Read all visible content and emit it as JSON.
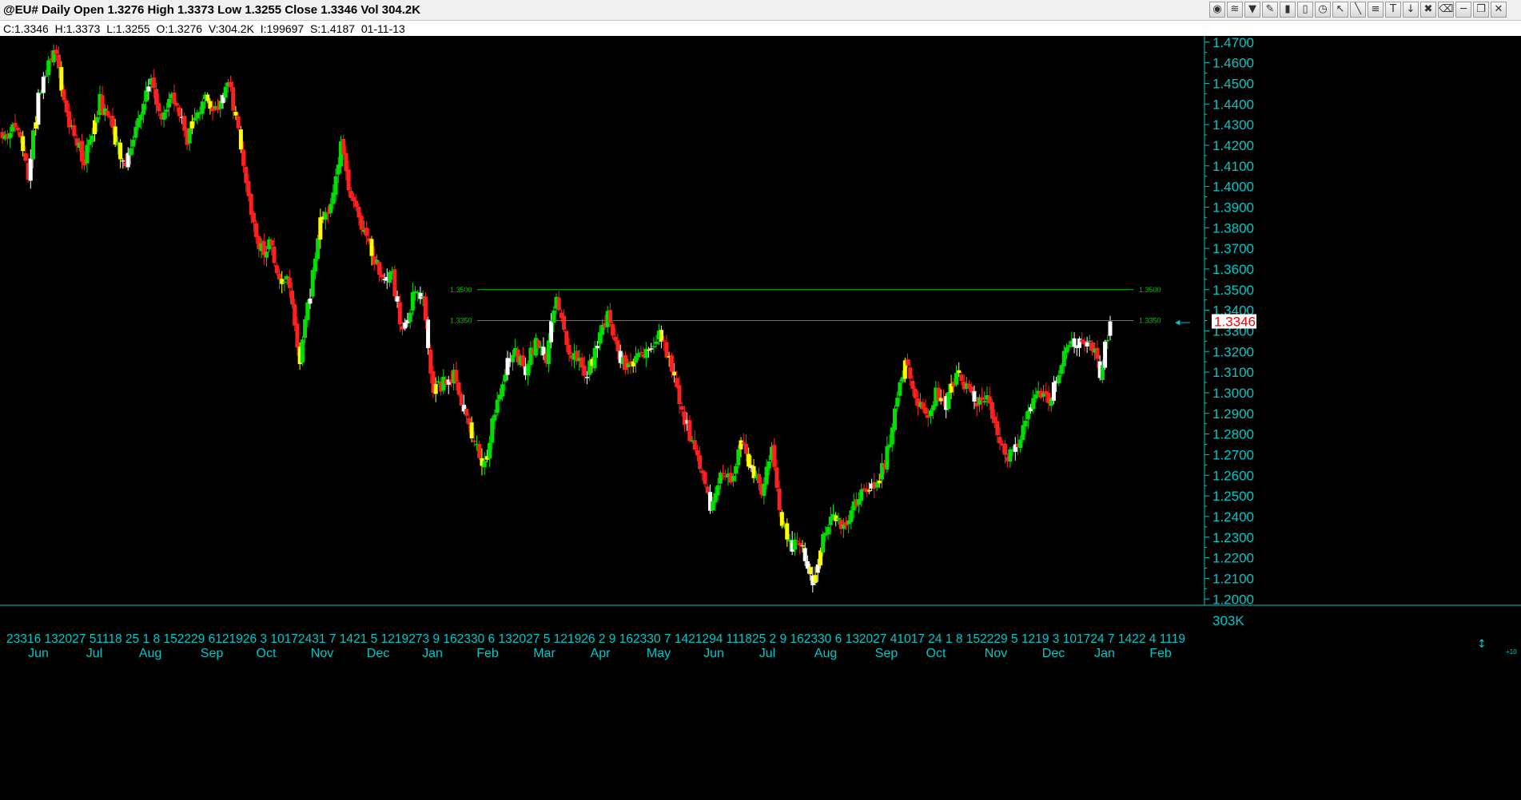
{
  "window": {
    "title": "@EU# Daily Open 1.3276 High 1.3373 Low 1.3255 Close 1.3346 Vol 304.2K"
  },
  "toolbar": {
    "buttons": [
      {
        "icon": "binoculars-icon",
        "glyph": "◉"
      },
      {
        "icon": "channel-icon",
        "glyph": "≋"
      },
      {
        "icon": "funnel-icon",
        "glyph": "▼"
      },
      {
        "icon": "pencil-icon",
        "glyph": "✎"
      },
      {
        "icon": "bar-chart-icon",
        "glyph": "▮"
      },
      {
        "icon": "bar-chart-alt-icon",
        "glyph": "▯"
      },
      {
        "icon": "clock-icon",
        "glyph": "◷"
      },
      {
        "icon": "cursor-icon",
        "glyph": "↖"
      },
      {
        "icon": "line-tool-icon",
        "glyph": "╲"
      },
      {
        "icon": "fib-icon",
        "glyph": "≡"
      },
      {
        "icon": "text-tool-icon",
        "glyph": "T"
      },
      {
        "icon": "arrow-down-icon",
        "glyph": "↓"
      },
      {
        "icon": "trash-icon",
        "glyph": "✖"
      },
      {
        "icon": "eraser-icon",
        "glyph": "⌫"
      },
      {
        "icon": "minimize-icon",
        "glyph": "─"
      },
      {
        "icon": "restore-icon",
        "glyph": "❐"
      },
      {
        "icon": "close-icon",
        "glyph": "✕"
      }
    ]
  },
  "infobar": {
    "text": "C:1.3346  H:1.3373  L:1.3255  O:1.3276  V:304.2K  I:199697  S:1.4187  01-11-13"
  },
  "colors": {
    "background": "#000000",
    "up_candle": "#00e000",
    "down_candle": "#ff2020",
    "doji_white": "#ffffff",
    "doji_yellow": "#ffff00",
    "axis": "#00c8c8",
    "hline": "#00c000",
    "price_marker_bg": "#ffffff",
    "price_marker_text": "#ff0000"
  },
  "chart_data": {
    "type": "candlestick",
    "symbol": "@EU#",
    "interval": "Daily",
    "y_range": [
      1.197,
      1.473
    ],
    "y_ticks": [
      "1.4700",
      "1.4600",
      "1.4500",
      "1.4400",
      "1.4300",
      "1.4200",
      "1.4100",
      "1.4000",
      "1.3900",
      "1.3800",
      "1.3700",
      "1.3600",
      "1.3500",
      "1.3400",
      "1.3300",
      "1.3200",
      "1.3100",
      "1.3000",
      "1.2900",
      "1.2800",
      "1.2700",
      "1.2600",
      "1.2500",
      "1.2400",
      "1.2300",
      "1.2200",
      "1.2100",
      "1.2000"
    ],
    "last_price": {
      "label": "1.3346",
      "value": 1.3346
    },
    "volume_label": "303K",
    "corner_label": "+10",
    "horizontal_lines": [
      {
        "value": 1.35,
        "label": "1.3500"
      },
      {
        "value": 1.335,
        "label": "1.3350"
      }
    ],
    "x_day_labels": "23316 132027 51118 25 1 8 152229 6121926 3 10172431 7 1421 5 1219273 9 162330 6 132027 5 121926 2 9 162330 7 1421294 111825 2 9 162330 6 132027 41017 24 1 8 152229 5 1219 3 101724 7 1422 4 1119",
    "months": [
      "Jun",
      "Jul",
      "Aug",
      "Sep",
      "Oct",
      "Nov",
      "Dec",
      "Jan",
      "Feb",
      "Mar",
      "Apr",
      "May",
      "Jun",
      "Jul",
      "Aug",
      "Sep",
      "Oct",
      "Nov",
      "Dec",
      "Jan",
      "Feb"
    ],
    "anchors": [
      [
        0,
        1.42
      ],
      [
        5,
        1.431
      ],
      [
        10,
        1.405
      ],
      [
        14,
        1.444
      ],
      [
        20,
        1.468
      ],
      [
        26,
        1.43
      ],
      [
        32,
        1.412
      ],
      [
        38,
        1.442
      ],
      [
        42,
        1.43
      ],
      [
        48,
        1.408
      ],
      [
        52,
        1.43
      ],
      [
        58,
        1.452
      ],
      [
        62,
        1.433
      ],
      [
        66,
        1.446
      ],
      [
        72,
        1.423
      ],
      [
        78,
        1.442
      ],
      [
        84,
        1.438
      ],
      [
        88,
        1.452
      ],
      [
        92,
        1.426
      ],
      [
        96,
        1.392
      ],
      [
        100,
        1.368
      ],
      [
        104,
        1.372
      ],
      [
        108,
        1.356
      ],
      [
        112,
        1.352
      ],
      [
        116,
        1.316
      ],
      [
        120,
        1.349
      ],
      [
        124,
        1.382
      ],
      [
        128,
        1.389
      ],
      [
        132,
        1.42
      ],
      [
        136,
        1.392
      ],
      [
        140,
        1.382
      ],
      [
        144,
        1.366
      ],
      [
        148,
        1.356
      ],
      [
        152,
        1.356
      ],
      [
        156,
        1.33
      ],
      [
        160,
        1.346
      ],
      [
        164,
        1.345
      ],
      [
        168,
        1.3
      ],
      [
        172,
        1.305
      ],
      [
        176,
        1.308
      ],
      [
        180,
        1.29
      ],
      [
        184,
        1.274
      ],
      [
        188,
        1.265
      ],
      [
        192,
        1.292
      ],
      [
        196,
        1.312
      ],
      [
        200,
        1.32
      ],
      [
        204,
        1.312
      ],
      [
        208,
        1.325
      ],
      [
        212,
        1.317
      ],
      [
        216,
        1.347
      ],
      [
        220,
        1.321
      ],
      [
        224,
        1.316
      ],
      [
        228,
        1.31
      ],
      [
        232,
        1.323
      ],
      [
        236,
        1.338
      ],
      [
        240,
        1.318
      ],
      [
        244,
        1.312
      ],
      [
        248,
        1.318
      ],
      [
        252,
        1.318
      ],
      [
        256,
        1.328
      ],
      [
        260,
        1.318
      ],
      [
        264,
        1.295
      ],
      [
        268,
        1.28
      ],
      [
        272,
        1.264
      ],
      [
        276,
        1.245
      ],
      [
        280,
        1.26
      ],
      [
        284,
        1.258
      ],
      [
        288,
        1.275
      ],
      [
        292,
        1.265
      ],
      [
        296,
        1.253
      ],
      [
        300,
        1.271
      ],
      [
        304,
        1.238
      ],
      [
        308,
        1.226
      ],
      [
        312,
        1.223
      ],
      [
        316,
        1.208
      ],
      [
        320,
        1.23
      ],
      [
        324,
        1.242
      ],
      [
        328,
        1.235
      ],
      [
        332,
        1.244
      ],
      [
        336,
        1.255
      ],
      [
        340,
        1.255
      ],
      [
        344,
        1.266
      ],
      [
        348,
        1.29
      ],
      [
        352,
        1.316
      ],
      [
        356,
        1.298
      ],
      [
        360,
        1.288
      ],
      [
        364,
        1.3
      ],
      [
        368,
        1.294
      ],
      [
        372,
        1.31
      ],
      [
        376,
        1.302
      ],
      [
        380,
        1.296
      ],
      [
        384,
        1.296
      ],
      [
        388,
        1.28
      ],
      [
        392,
        1.27
      ],
      [
        396,
        1.275
      ],
      [
        400,
        1.289
      ],
      [
        404,
        1.3
      ],
      [
        408,
        1.296
      ],
      [
        412,
        1.31
      ],
      [
        416,
        1.326
      ],
      [
        420,
        1.324
      ],
      [
        424,
        1.326
      ],
      [
        428,
        1.31
      ],
      [
        432,
        1.3346
      ]
    ]
  }
}
